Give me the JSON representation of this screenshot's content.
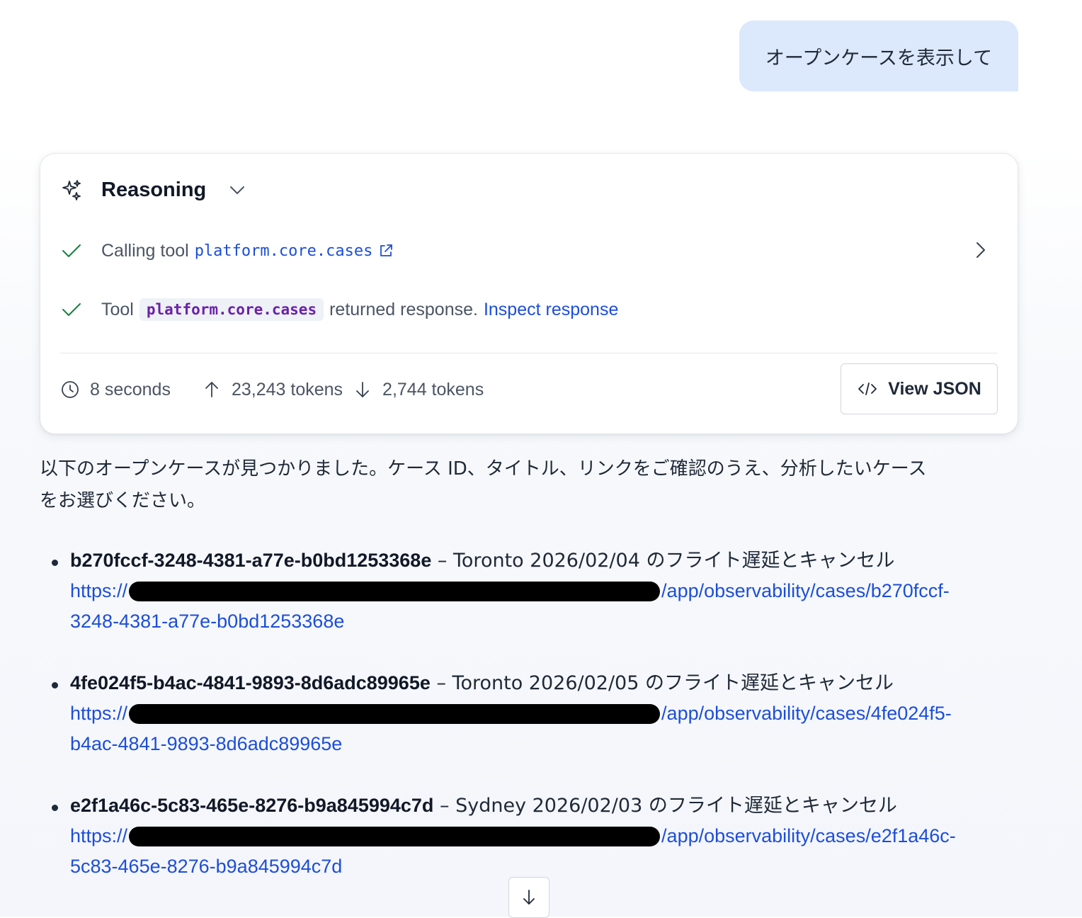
{
  "user_message": "オープンケースを表示して",
  "reasoning": {
    "title": "Reasoning",
    "steps": [
      {
        "prefix": "Calling tool",
        "tool": "platform.core.cases"
      },
      {
        "prefix": "Tool",
        "tool": "platform.core.cases",
        "suffix": "returned response.",
        "link": "Inspect response"
      }
    ],
    "stats": {
      "duration": "8 seconds",
      "tokens_in": "23,243 tokens",
      "tokens_out": "2,744 tokens"
    },
    "view_json_label": "View JSON"
  },
  "response": {
    "intro_line1": "以下のオープンケースが見つかりました。ケース ID、タイトル、リンクをご確認のうえ、分析したいケース",
    "intro_line2": "をお選びください。",
    "cases": [
      {
        "id": "b270fccf-3248-4381-a77e-b0bd1253368e",
        "title": " – Toronto 2026/02/04 のフライト遅延とキャンセル",
        "url_prefix": "https://",
        "url_suffix": "/app/observability/cases/b270fccf-",
        "url_line2": "3248-4381-a77e-b0bd1253368e"
      },
      {
        "id": "4fe024f5-b4ac-4841-9893-8d6adc89965e",
        "title": " – Toronto 2026/02/05 のフライト遅延とキャンセル",
        "url_prefix": "https://",
        "url_suffix": "/app/observability/cases/4fe024f5-",
        "url_line2": "b4ac-4841-9893-8d6adc89965e"
      },
      {
        "id": "e2f1a46c-5c83-465e-8276-b9a845994c7d",
        "title": " – Sydney 2026/02/03 のフライト遅延とキャンセル",
        "url_prefix": "https://",
        "url_suffix": "/app/observability/cases/e2f1a46c-",
        "url_line2": "5c83-465e-8276-b9a845994c7d"
      }
    ]
  },
  "colors": {
    "user_bubble": "#dce8fc",
    "link": "#1d4ed8",
    "tool_chip_text": "#6b21a8",
    "check": "#15803d"
  },
  "icons": {
    "reasoning": "sparkles-icon",
    "collapse": "chevron-down-icon",
    "step_done": "check-icon",
    "external": "external-link-icon",
    "expand": "chevron-right-icon",
    "duration": "clock-icon",
    "input_tokens": "arrow-up-icon",
    "output_tokens": "arrow-down-icon",
    "json": "code-icon",
    "scroll": "arrow-down-icon"
  }
}
